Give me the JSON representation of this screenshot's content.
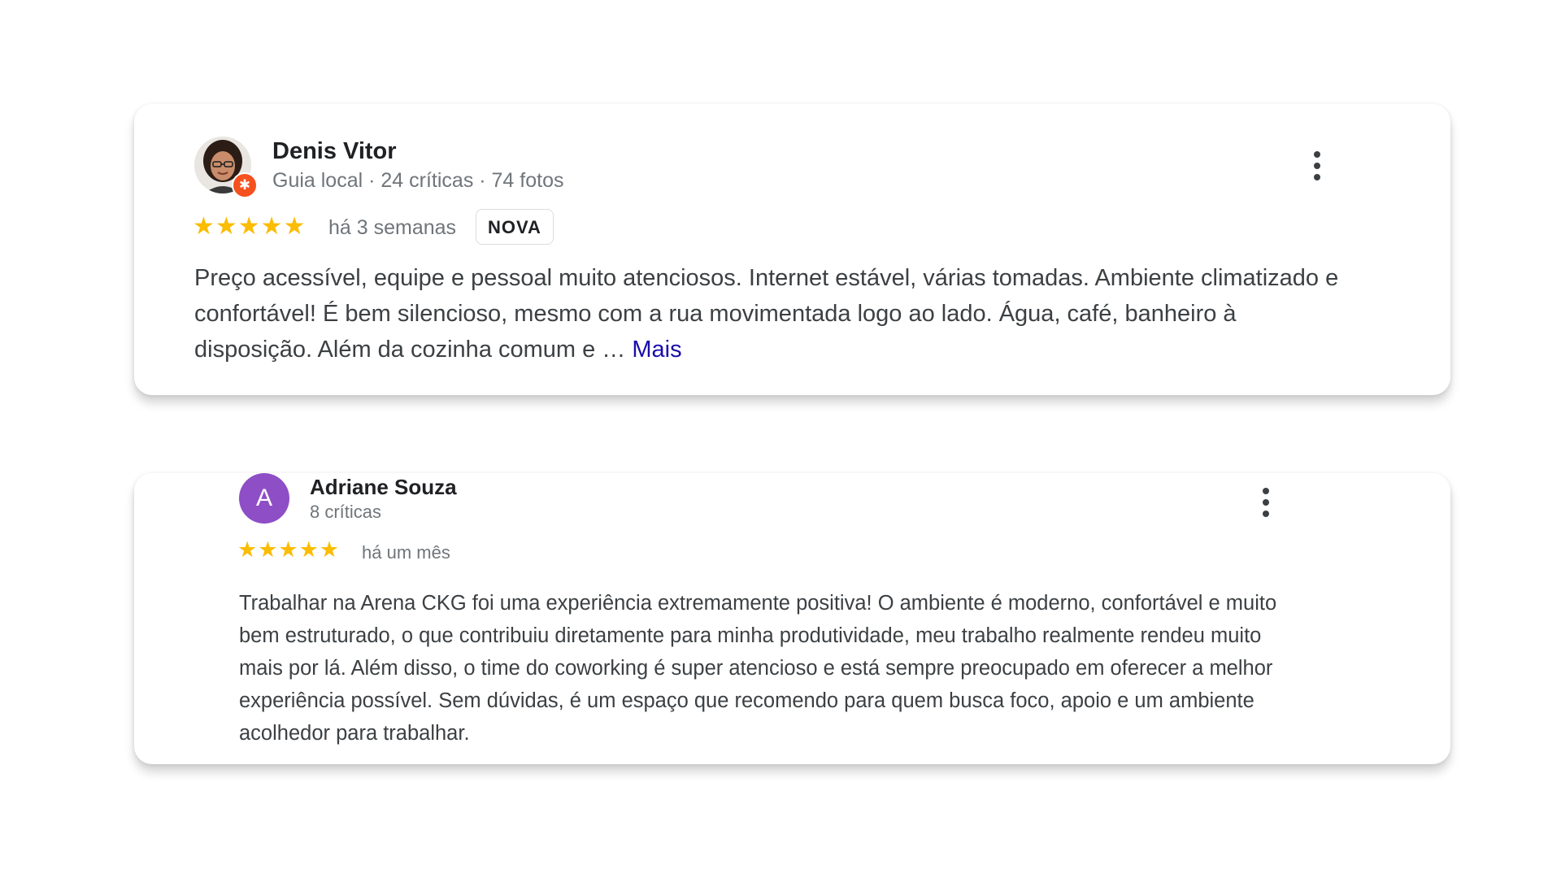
{
  "reviews": [
    {
      "author": "Denis Vitor",
      "meta": "Guia local · 24 críticas · 74 fotos",
      "stars": "★★★★★",
      "rating": 5,
      "date": "há 3 semanas",
      "badge": "NOVA",
      "text": "Preço acessível, equipe e pessoal muito atenciosos. Internet estável, várias tomadas. Ambiente climatizado e confortável! É bem silencioso, mesmo com a rua movimentada logo ao lado. Água, café, banheiro à disposição. Além da cozinha comum e … ",
      "more_label": "Mais",
      "avatar_badge_icon": "local-guide-star-icon",
      "menu_icon": "more-vert-icon"
    },
    {
      "author": "Adriane Souza",
      "avatar_initial": "A",
      "meta": "8 críticas",
      "stars": "★★★★★",
      "rating": 5,
      "date": "há um mês",
      "text": "Trabalhar na Arena CKG foi uma experiência extremamente positiva! O ambiente é moderno, confortável e muito bem estruturado, o que contribuiu diretamente para minha produtividade, meu trabalho realmente rendeu muito mais por lá. Além disso, o time do coworking é super atencioso e está sempre preocupado em oferecer a melhor experiência possível. Sem dúvidas, é um espaço que recomendo para quem busca foco, apoio e um ambiente acolhedor para trabalhar.",
      "menu_icon": "more-vert-icon"
    }
  ],
  "colors": {
    "star": "#fbbc04",
    "link": "#1a0dab",
    "avatar_purple": "#8e4ec6",
    "guide_badge": "#f4511e"
  }
}
